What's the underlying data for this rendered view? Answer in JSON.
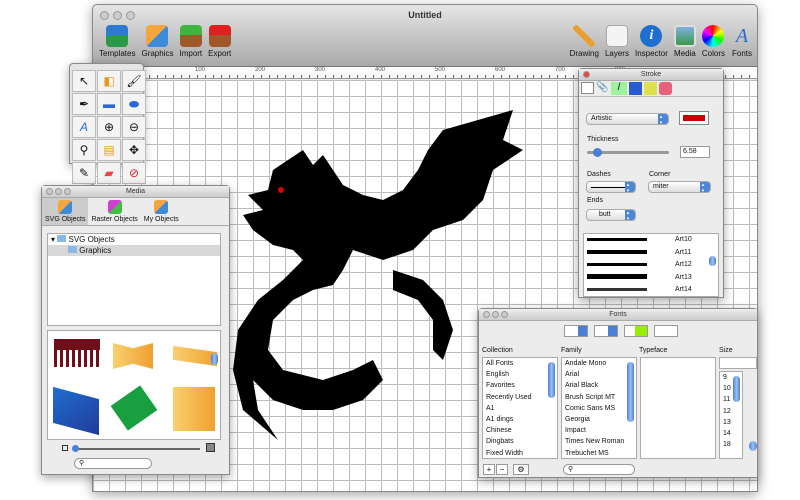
{
  "window": {
    "title": "Untitled"
  },
  "toolbar": {
    "left": [
      "Templates",
      "Graphics",
      "Import",
      "Export"
    ],
    "right": [
      "Drawing",
      "Layers",
      "Inspector",
      "Media",
      "Colors",
      "Fonts"
    ]
  },
  "ruler": [
    "100",
    "200",
    "300",
    "400",
    "500",
    "600",
    "700",
    "800"
  ],
  "stroke": {
    "title": "Stroke",
    "type": "Artistic",
    "color": "#cc0000",
    "thickness_label": "Thickness",
    "thickness": "6.58",
    "thickness_fraction": 0.12,
    "dashes_label": "Dashes",
    "corner_label": "Corner",
    "corner": "miter",
    "ends_label": "Ends",
    "ends": "butt",
    "brushes": [
      "Art10",
      "Art11",
      "Art12",
      "Art13",
      "Art14"
    ]
  },
  "media": {
    "title": "Media",
    "tabs": [
      "SVG Objects",
      "Raster Objects",
      "My Objects"
    ],
    "tree": [
      "SVG Objects",
      "Graphics"
    ]
  },
  "fonts": {
    "title": "Fonts",
    "headers": [
      "Collection",
      "Family",
      "Typeface",
      "Size"
    ],
    "collections": [
      "All Fonts",
      "English",
      "Favorites",
      "Recently Used",
      "A1",
      "A1 dings",
      "Chinese",
      "Dingbats",
      "Fixed Width"
    ],
    "families": [
      "Andale Mono",
      "Arial",
      "Arial Black",
      "Brush Script MT",
      "Comic Sans MS",
      "Georgia",
      "Impact",
      "Times New Roman",
      "Trebuchet MS"
    ],
    "sizes": [
      "9",
      "10",
      "11",
      "12",
      "13",
      "14",
      "18"
    ],
    "text_color": "#99ee00",
    "add": "+",
    "remove": "−"
  }
}
